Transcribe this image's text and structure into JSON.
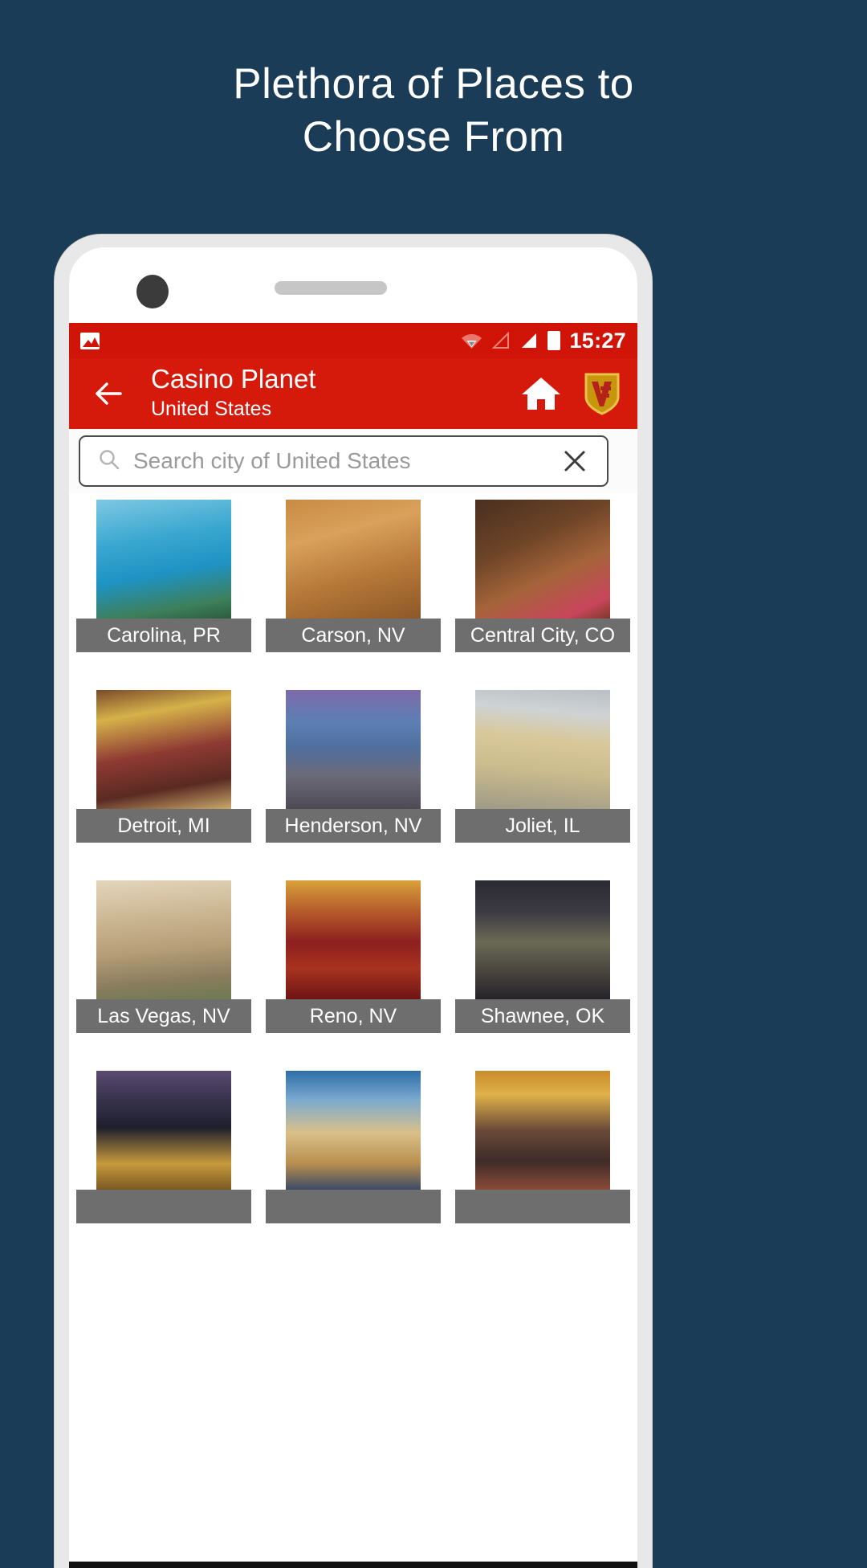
{
  "promo": {
    "headline_line1": "Plethora of Places to",
    "headline_line2": "Choose From",
    "background_color": "#1a3c56"
  },
  "status_bar": {
    "time": "15:27",
    "icons": [
      "image-icon",
      "wifi-icon",
      "signal-empty-icon",
      "signal-full-icon",
      "battery-icon"
    ],
    "background_color": "#d01408"
  },
  "app_bar": {
    "back_label": "←",
    "title": "Casino Planet",
    "subtitle": "United States",
    "home_icon": "home-icon",
    "logo_icon": "shield-badge-logo",
    "background_color": "#d51a0b"
  },
  "search": {
    "placeholder": "Search city of United States",
    "value": "",
    "search_icon": "search-icon",
    "clear_icon": "close-icon"
  },
  "grid": {
    "rows": [
      [
        {
          "label": "Carolina, PR"
        },
        {
          "label": "Carson, NV"
        },
        {
          "label": "Central City, CO"
        }
      ],
      [
        {
          "label": "Detroit, MI"
        },
        {
          "label": "Henderson, NV"
        },
        {
          "label": "Joliet, IL"
        }
      ],
      [
        {
          "label": "Las Vegas, NV"
        },
        {
          "label": "Reno, NV"
        },
        {
          "label": "Shawnee, OK"
        }
      ],
      [
        {
          "label": ""
        },
        {
          "label": ""
        },
        {
          "label": ""
        }
      ]
    ]
  }
}
